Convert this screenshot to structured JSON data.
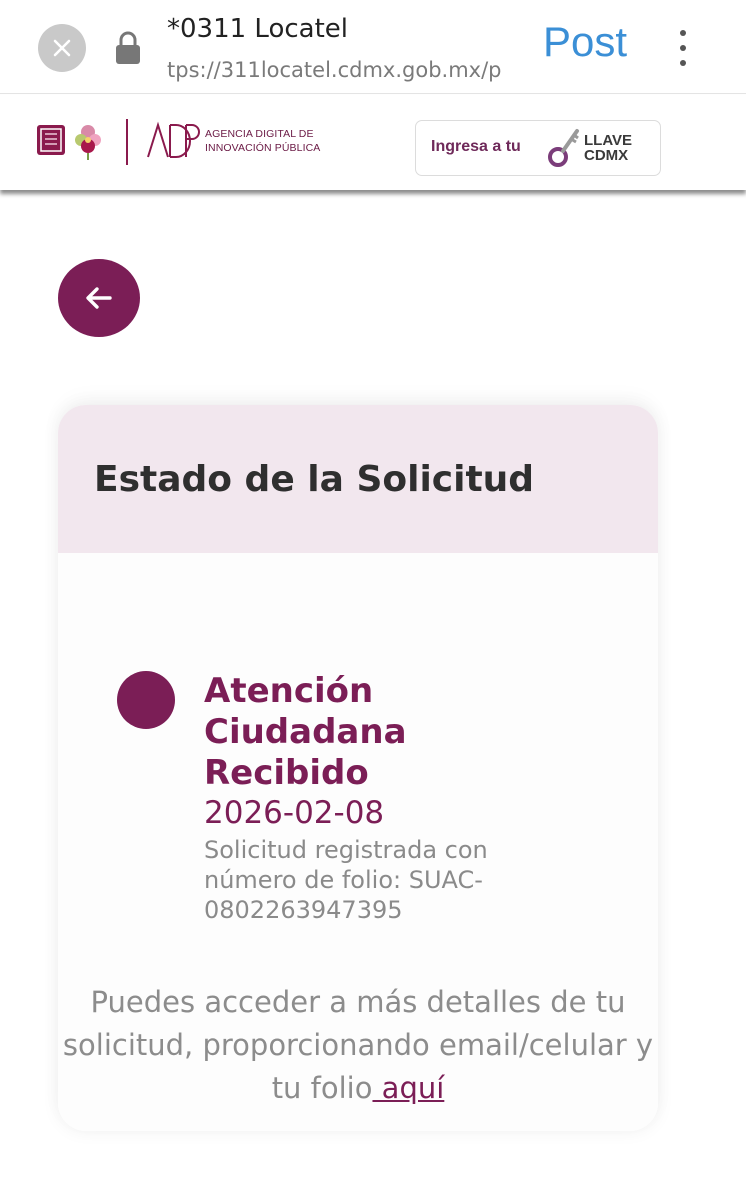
{
  "browser": {
    "title": "*0311 Locatel",
    "url": "tps://311locatel.cdmx.gob.mx/p",
    "post_label": "Post"
  },
  "header": {
    "agency_line1": "AGENCIA DIGITAL DE",
    "agency_line2": "INNOVACIÓN PÚBLICA",
    "llave_prefix": "Ingresa a tu",
    "llave_word1": "LLAVE",
    "llave_word2": "CDMX"
  },
  "card": {
    "title": "Estado de la Solicitud",
    "status": {
      "title": "Atención Ciudadana Recibido",
      "date": "2026-02-08",
      "description": "Solicitud registrada con número de folio: SUAC-0802263947395"
    },
    "more_info_text": "Puedes acceder a más detalles de tu solicitud, proporcionando email/celular y tu folio",
    "more_info_link": " aquí"
  },
  "colors": {
    "brand": "#7b1e56",
    "header_bg": "#f2e7ee",
    "post_blue": "#3b8fd6"
  },
  "icons": [
    "close-icon",
    "lock-icon",
    "more-vert-icon",
    "arrow-left-icon",
    "key-icon"
  ]
}
